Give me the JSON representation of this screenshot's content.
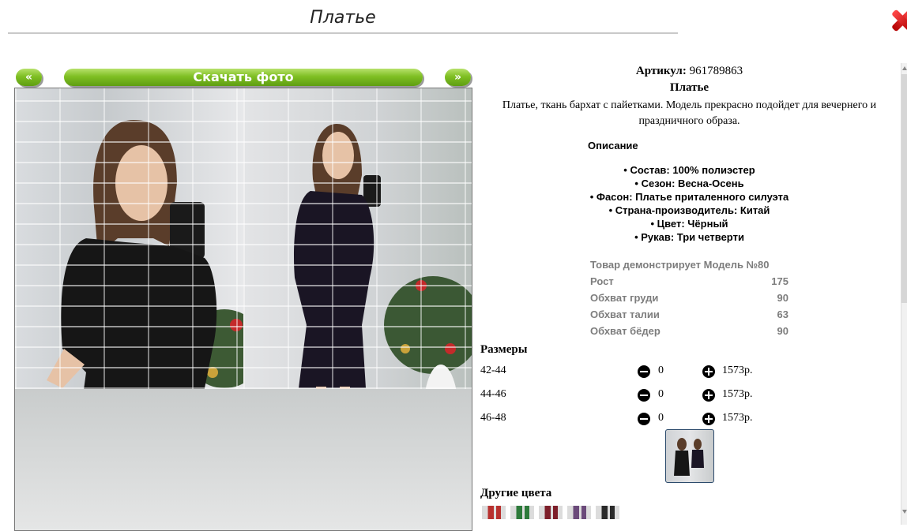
{
  "page": {
    "title": "Платье"
  },
  "gallery": {
    "prev_label": "«",
    "download_label": "Скачать фото",
    "next_label": "»"
  },
  "product": {
    "sku_label": "Артикул:",
    "sku_value": "961789863",
    "name": "Платье",
    "description": "Платье, ткань бархат с пайетками. Модель прекрасно подойдет для вечернего и праздничного образа.",
    "description_heading": "Описание",
    "attributes": [
      "• Состав: 100% полиэстер",
      "• Сезон: Весна-Осень",
      "• Фасон: Платье приталенного силуэта",
      "• Страна-производитель: Китай",
      "• Цвет: Чёрный",
      "• Рукав: Три четверти"
    ],
    "model": [
      {
        "label": "Товар демонстрирует Модель №80",
        "value": ""
      },
      {
        "label": "Рост",
        "value": "175"
      },
      {
        "label": "Обхват груди",
        "value": "90"
      },
      {
        "label": "Обхват талии",
        "value": "63"
      },
      {
        "label": "Обхват бёдер",
        "value": "90"
      }
    ]
  },
  "sizes": {
    "heading": "Размеры",
    "rows": [
      {
        "size": "42-44",
        "qty": "0",
        "price": "1573р."
      },
      {
        "size": "44-46",
        "qty": "0",
        "price": "1573р."
      },
      {
        "size": "46-48",
        "qty": "0",
        "price": "1573р."
      }
    ]
  },
  "other_colors": {
    "heading": "Другие цвета",
    "swatches": [
      "#b8312f",
      "#2d7a3a",
      "#7d1f2a",
      "#6b4a7a",
      "#2a2a2a"
    ]
  },
  "colors": {
    "accent_green": "#7fbf23",
    "close_red": "#d40000"
  }
}
